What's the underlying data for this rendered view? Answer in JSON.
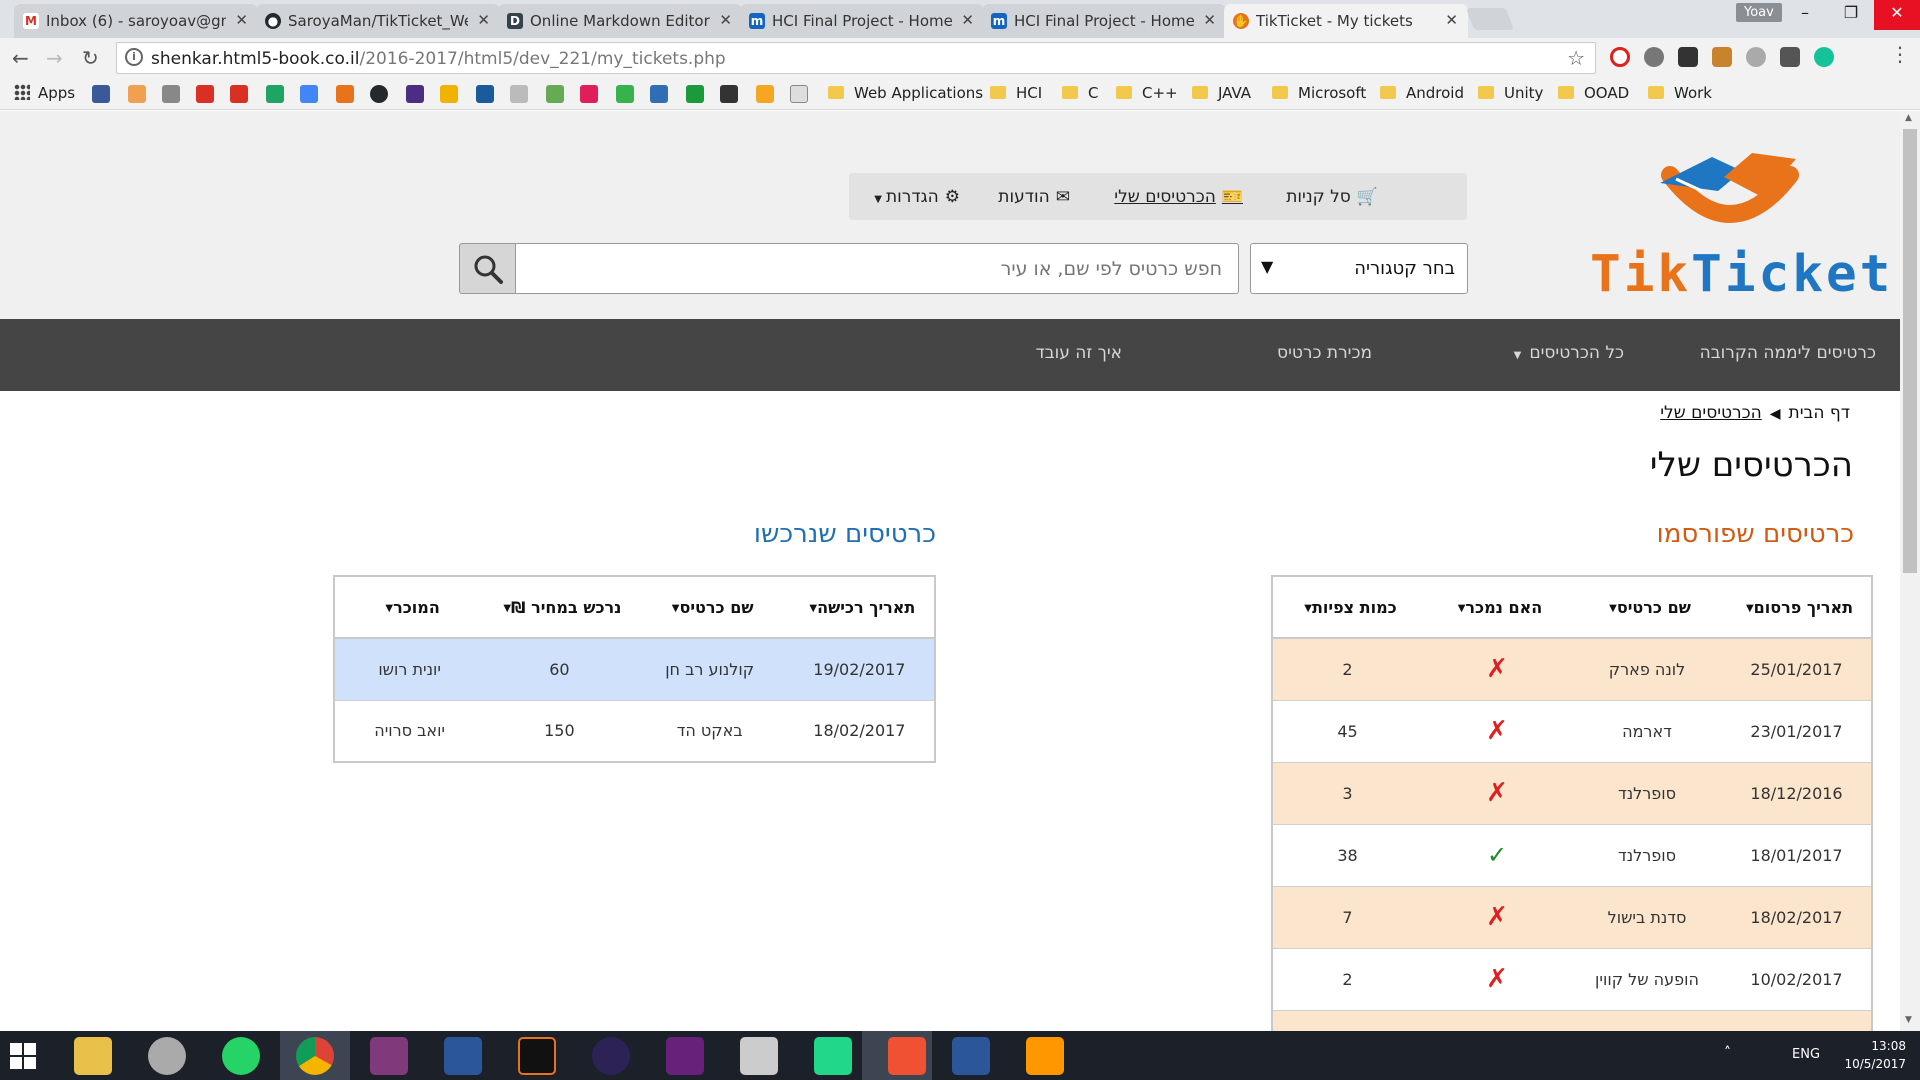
{
  "browser": {
    "tabs": [
      {
        "label": "Inbox (6) - saroyoav@gm",
        "favicon": "gmail-icon",
        "color": "#d93025"
      },
      {
        "label": "SaroyaMan/TikTicket_We",
        "favicon": "github-icon",
        "color": "#24292e"
      },
      {
        "label": "Online Markdown Editor",
        "favicon": "dillinger-icon",
        "color": "#35424a"
      },
      {
        "label": "HCI Final Project - Home",
        "favicon": "m-icon",
        "color": "#1565c0"
      },
      {
        "label": "HCI Final Project - Home",
        "favicon": "m-icon",
        "color": "#1565c0"
      },
      {
        "label": "TikTicket - My tickets",
        "favicon": "tikticket-icon",
        "color": "#e8731a"
      }
    ],
    "window_user": "Yoav",
    "url_domain": "shenkar.html5-book.co.il",
    "url_path": "/2016-2017/html5/dev_221/my_tickets.php",
    "bookmarks": {
      "apps_label": "Apps",
      "folders": [
        "Web Applications",
        "HCI",
        "C",
        "C++",
        "JAVA",
        "Microsoft",
        "Android",
        "Unity",
        "OOAD",
        "Work"
      ]
    }
  },
  "site": {
    "logo_part1": "Tik",
    "logo_part2": "Ticket",
    "user_nav": {
      "cart": "סל קניות",
      "my_tickets": "הכרטיסים שלי",
      "messages": "הודעות",
      "settings": "הגדרות"
    },
    "category_select": "בחר קטגוריה",
    "search_placeholder": "חפש כרטיס לפי שם, או עיר",
    "main_nav": {
      "upcoming": "כרטיסים ליממה הקרובה",
      "all_tickets": "כל הכרטיסים",
      "sell": "מכירת כרטיס",
      "how": "איך זה עובד"
    },
    "breadcrumb": {
      "home": "דף הבית",
      "current": "הכרטיסים שלי"
    },
    "page_title": "הכרטיסים שלי"
  },
  "published": {
    "heading": "כרטיסים שפורסמו",
    "columns": {
      "date": "תאריך פרסום",
      "name": "שם כרטיס",
      "sold": "האם נמכר",
      "views": "כמות צפיות"
    },
    "rows": [
      {
        "date": "25/01/2017",
        "name": "לונה פארק",
        "sold": "✗",
        "views": "2"
      },
      {
        "date": "23/01/2017",
        "name": "דארמה",
        "sold": "✗",
        "views": "45"
      },
      {
        "date": "18/12/2016",
        "name": "סופרלנד",
        "sold": "✗",
        "views": "3"
      },
      {
        "date": "18/01/2017",
        "name": "סופרלנד",
        "sold": "✓",
        "views": "38"
      },
      {
        "date": "18/02/2017",
        "name": "סדנת בישול",
        "sold": "✗",
        "views": "7"
      },
      {
        "date": "10/02/2017",
        "name": "הופעה של קווין",
        "sold": "✗",
        "views": "2"
      }
    ]
  },
  "purchased": {
    "heading": "כרטיסים שנרכשו",
    "columns": {
      "date": "תאריך רכישה",
      "name": "שם כרטיס",
      "price": "נרכש במחיר ₪",
      "seller": "המוכר"
    },
    "rows": [
      {
        "date": "19/02/2017",
        "name": "קולנוע רב חן",
        "price": "60",
        "seller": "יונית רושו"
      },
      {
        "date": "18/02/2017",
        "name": "באקט הד",
        "price": "150",
        "seller": "יואב סרויה"
      }
    ]
  },
  "taskbar": {
    "language": "ENG",
    "time": "13:08",
    "date": "10/5/2017"
  },
  "colors": {
    "accent_orange": "#e8731a",
    "accent_blue": "#1f77c4",
    "nav_bg": "#454545",
    "row_peach": "#fbe5cd",
    "row_blue": "#cfe1fb"
  }
}
